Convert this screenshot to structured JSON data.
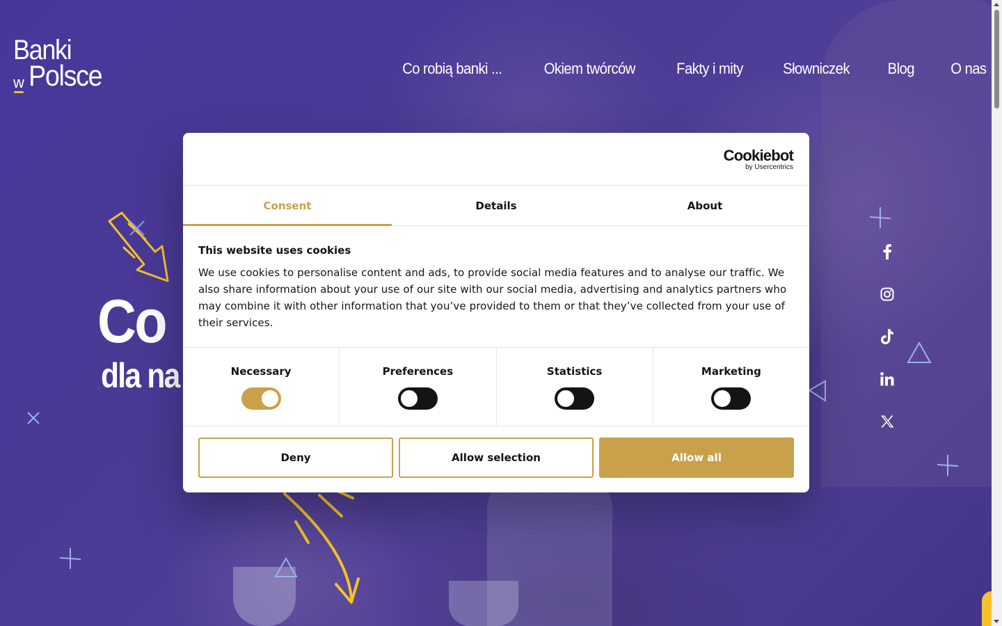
{
  "site": {
    "logo": {
      "line1": "Banki",
      "small": "w",
      "line2": "Polsce"
    },
    "nav": [
      "Co robią banki ...",
      "Okiem twórców",
      "Fakty i mity",
      "Słowniczek",
      "Blog",
      "O nas"
    ],
    "hero": {
      "title": "Co",
      "subtitle": "dla na"
    },
    "social_icons": [
      "facebook-icon",
      "instagram-icon",
      "tiktok-icon",
      "linkedin-icon",
      "x-icon"
    ],
    "accent_yellow": "#f5c22b",
    "bg_purple": "#4a3a93"
  },
  "cookie_dialog": {
    "brand": {
      "name": "Cookiebot",
      "sub": "by Usercentrics"
    },
    "tabs": [
      "Consent",
      "Details",
      "About"
    ],
    "active_tab": "Consent",
    "heading": "This website uses cookies",
    "text": "We use cookies to personalise content and ads, to provide social media features and to analyse our traffic. We also share information about your use of our site with our social media, advertising and analytics partners who may combine it with other information that you’ve provided to them or that they’ve collected from your use of their services.",
    "categories": [
      {
        "label": "Necessary",
        "on": true
      },
      {
        "label": "Preferences",
        "on": false
      },
      {
        "label": "Statistics",
        "on": false
      },
      {
        "label": "Marketing",
        "on": false
      }
    ],
    "buttons": {
      "deny": "Deny",
      "allow_selection": "Allow selection",
      "allow_all": "Allow all"
    },
    "accent": "#c9a14a"
  }
}
